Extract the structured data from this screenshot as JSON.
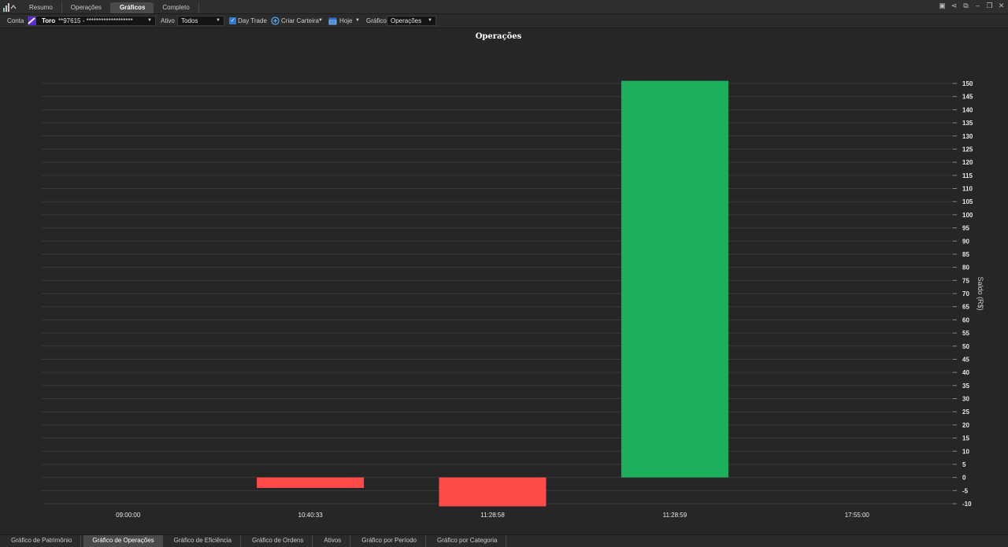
{
  "top_tabs": [
    {
      "label": "Resumo",
      "active": false
    },
    {
      "label": "Operações",
      "active": false
    },
    {
      "label": "Gráficos",
      "active": true
    },
    {
      "label": "Completo",
      "active": false
    }
  ],
  "toolbar": {
    "conta_label": "Conta",
    "broker": "Toro",
    "account": "**97615 - *******************",
    "ativo_label": "Ativo",
    "ativo_value": "Todos",
    "day_trade_label": "Day Trade",
    "day_trade_checked": true,
    "criar_carteira_label": "Criar Carteira",
    "period_label": "Hoje",
    "grafico_label": "Gráfico",
    "grafico_value": "Operações"
  },
  "chart_data": {
    "type": "bar",
    "title": "Operações",
    "ylabel": "Saldo (R$)",
    "categories": [
      "09:00:00",
      "10:40:33",
      "11:28:58",
      "11:28:59",
      "17:55:00"
    ],
    "values": [
      null,
      -4,
      -11,
      151,
      null
    ],
    "ylim": [
      -10,
      150
    ],
    "ytick_step": 5,
    "grid": true,
    "axis_side": "right",
    "positive_color": "#1eaf5c",
    "negative_color": "#ff4a4a"
  },
  "bottom_tabs": [
    {
      "label": "Gráfico de Patrimônio",
      "active": false
    },
    {
      "label": "Gráfico de Operações",
      "active": true
    },
    {
      "label": "Gráfico de Eficiência",
      "active": false
    },
    {
      "label": "Gráfico de Ordens",
      "active": false
    },
    {
      "label": "Ativos",
      "active": false
    },
    {
      "label": "Gráfico por Período",
      "active": false
    },
    {
      "label": "Gráfico por Categoria",
      "active": false
    }
  ],
  "colors": {
    "background": "#262626",
    "accent": "#2f7ad6"
  }
}
